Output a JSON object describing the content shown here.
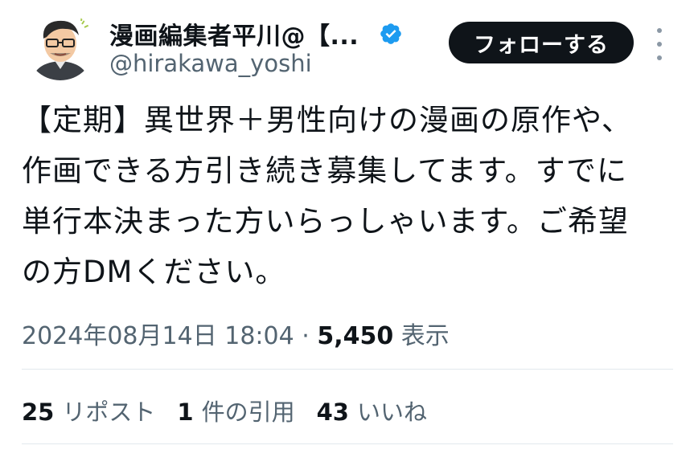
{
  "author": {
    "display_name": "漫画編集者平川@【...",
    "handle": "@hirakawa_yoshi",
    "verified_icon": "verified-badge-icon",
    "verified_color": "#1d9bf0"
  },
  "follow_button": {
    "label": "フォローする"
  },
  "more_icon": "more-vertical-icon",
  "tweet": {
    "lines": [
      "【定期】異世界＋男性向けの漫画の原作や、",
      "作画できる方引き続き募集してます。すでに",
      "単行本決まった方いらっしゃいます。ご希望",
      "の方DMください。"
    ]
  },
  "meta": {
    "timestamp": "2024年08月14日 18:04",
    "separator": "·",
    "views_count": "5,450",
    "views_label": "表示"
  },
  "stats": {
    "reposts_count": "25",
    "reposts_label": "リポスト",
    "quotes_count": "1",
    "quotes_label": "件の引用",
    "likes_count": "43",
    "likes_label": "いいね"
  },
  "colors": {
    "text_primary": "#0f1419",
    "text_secondary": "#536471",
    "follow_button_bg": "#0f1419"
  }
}
